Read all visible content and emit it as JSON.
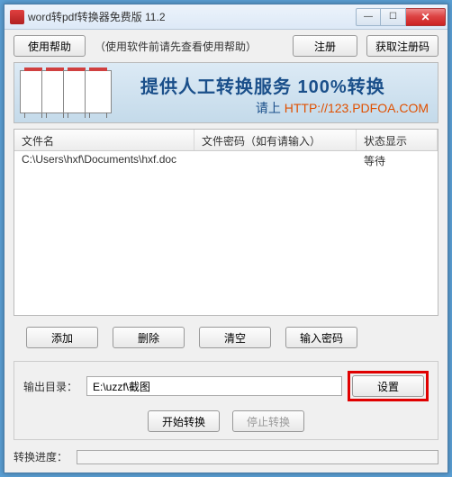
{
  "titlebar": {
    "title": "word转pdf转换器免费版 11.2"
  },
  "toprow": {
    "help_label": "使用帮助",
    "hint": "（使用软件前请先查看使用帮助）",
    "register_label": "注册",
    "get_code_label": "获取注册码"
  },
  "banner": {
    "title": "提供人工转换服务 100%转换",
    "sub_prefix": "请上 ",
    "sub_url": "HTTP://123.PDFOA.COM"
  },
  "table": {
    "headers": {
      "filename": "文件名",
      "password": "文件密码（如有请输入）",
      "status": "状态显示"
    },
    "rows": [
      {
        "filename": "C:\\Users\\hxf\\Documents\\hxf.doc",
        "password": "",
        "status": "等待"
      }
    ]
  },
  "buttons": {
    "add": "添加",
    "delete": "删除",
    "clear": "清空",
    "enter_password": "输入密码"
  },
  "output": {
    "label": "输出目录：",
    "path": "E:\\uzzf\\截图",
    "set_label": "设置",
    "start_label": "开始转换",
    "stop_label": "停止转换"
  },
  "progress": {
    "label": "转换进度："
  }
}
